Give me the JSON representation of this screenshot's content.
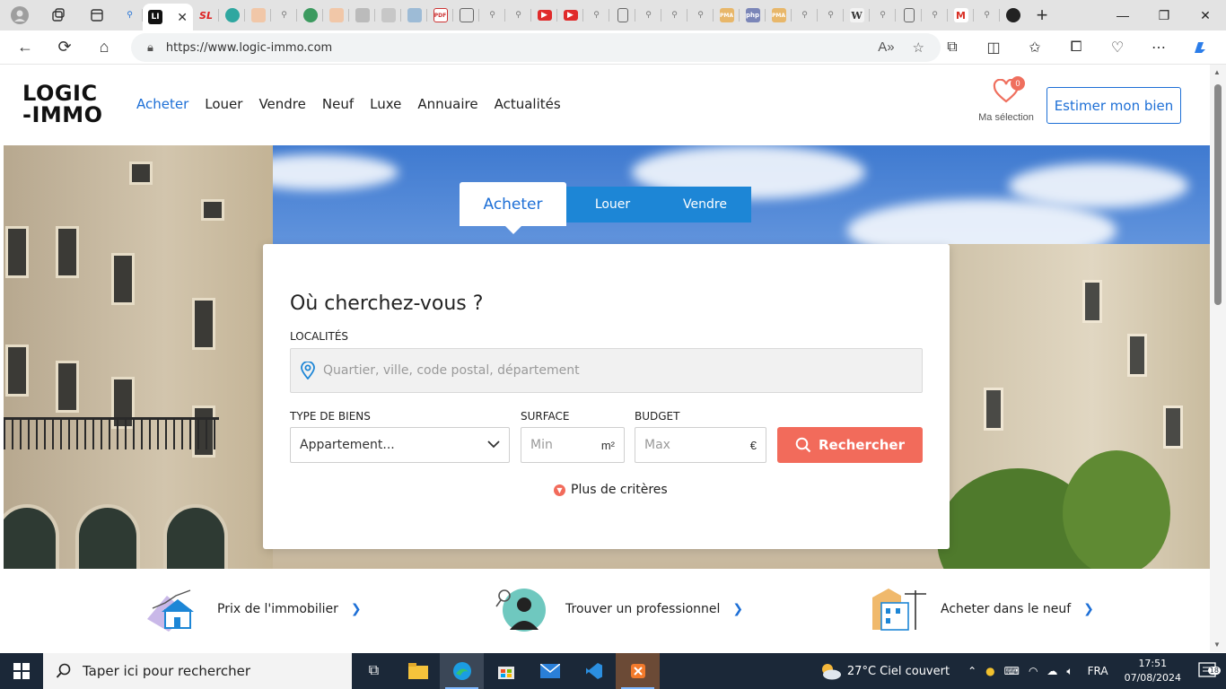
{
  "browser": {
    "url": "https://www.logic-immo.com",
    "active_tab_favicon": "LI",
    "tabs_favicons": [
      "search",
      "LI",
      "SL",
      "edge",
      "photo",
      "search",
      "globe",
      "photo",
      "file",
      "folder",
      "monitor",
      "pdf",
      "grid",
      "search",
      "search",
      "youtube",
      "youtube",
      "search",
      "doc",
      "search",
      "search",
      "search",
      "pma",
      "php",
      "pma",
      "search",
      "search",
      "W",
      "search",
      "file",
      "search",
      "gmail",
      "search",
      "github"
    ],
    "window_controls": [
      "minimize-icon",
      "restore-icon",
      "close-icon"
    ]
  },
  "site": {
    "logo_line1": "LOGIC",
    "logo_line2": "-IMMO",
    "nav": [
      "Acheter",
      "Louer",
      "Vendre",
      "Neuf",
      "Luxe",
      "Annuaire",
      "Actualités"
    ],
    "selection_count": "0",
    "selection_label": "Ma sélection",
    "estimate_button": "Estimer mon bien"
  },
  "search": {
    "tabs": [
      "Acheter",
      "Louer",
      "Vendre"
    ],
    "title": "Où cherchez-vous ?",
    "localites_label": "LOCALITÉS",
    "localites_placeholder": "Quartier, ville, code postal, département",
    "type_label": "TYPE DE BIENS",
    "type_value": "Appartement...",
    "surface_label": "SURFACE",
    "surface_placeholder": "Min",
    "surface_unit": "m²",
    "budget_label": "BUDGET",
    "budget_placeholder": "Max",
    "budget_unit": "€",
    "search_button": "Rechercher",
    "more_criteria": "Plus de critères"
  },
  "quicklinks": [
    {
      "label": "Prix de l'immobilier"
    },
    {
      "label": "Trouver un professionnel"
    },
    {
      "label": "Acheter dans le neuf"
    }
  ],
  "taskbar": {
    "search_placeholder": "Taper ici pour rechercher",
    "weather": "27°C  Ciel couvert",
    "lang": "FRA",
    "time": "17:51",
    "date": "07/08/2024",
    "notifications": "18"
  },
  "colors": {
    "accent": "#1d6fd6",
    "tab_blue": "#1d86d6",
    "cta": "#f26b5b"
  }
}
